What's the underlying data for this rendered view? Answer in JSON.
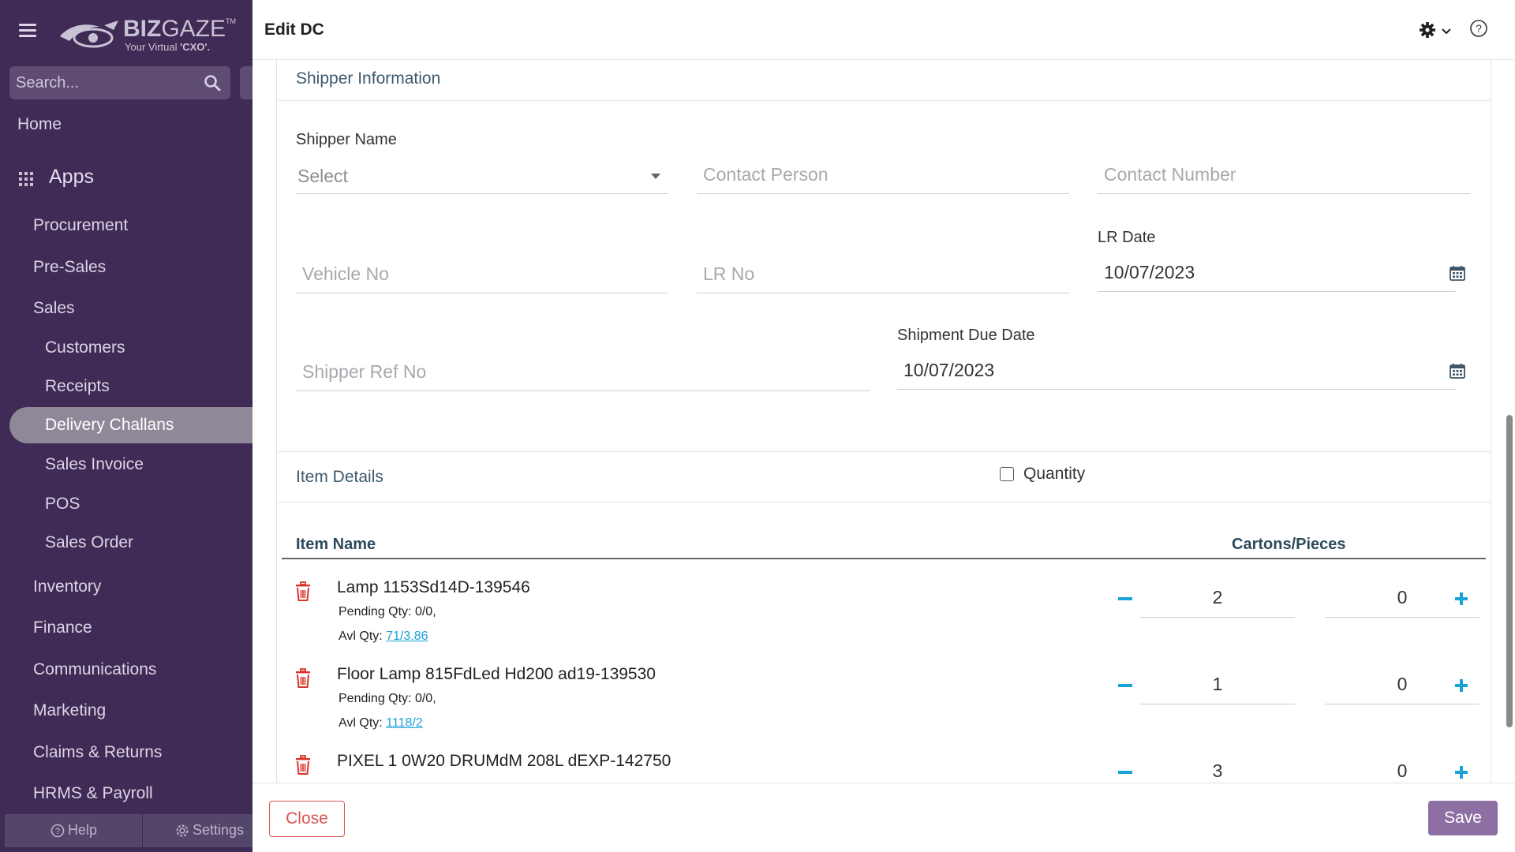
{
  "app": {
    "logo_name_bold": "BIZ",
    "logo_name_light": "GAZE",
    "logo_tm": "TM",
    "logo_tagline_prefix": "Your Virtual ",
    "logo_tagline_bold": "'CXO'."
  },
  "sidebar": {
    "search_placeholder": "Search...",
    "home": "Home",
    "apps": "Apps",
    "items": [
      {
        "label": "Procurement"
      },
      {
        "label": "Pre-Sales"
      },
      {
        "label": "Sales"
      },
      {
        "label": "Customers"
      },
      {
        "label": "Receipts"
      },
      {
        "label": "Delivery Challans"
      },
      {
        "label": "Sales Invoice"
      },
      {
        "label": "POS"
      },
      {
        "label": "Sales Order"
      },
      {
        "label": "Inventory"
      },
      {
        "label": "Finance"
      },
      {
        "label": "Communications"
      },
      {
        "label": "Marketing"
      },
      {
        "label": "Claims & Returns"
      },
      {
        "label": "HRMS & Payroll"
      }
    ],
    "active_item": "Delivery Challans",
    "help": "Help",
    "settings": "Settings"
  },
  "header": {
    "title": "Edit DC"
  },
  "shipper": {
    "section_title": "Shipper Information",
    "shipper_name_label": "Shipper Name",
    "shipper_name_value": "Select",
    "contact_person_placeholder": "Contact Person",
    "contact_number_placeholder": "Contact Number",
    "vehicle_no_placeholder": "Vehicle No",
    "lr_no_placeholder": "LR No",
    "lr_date_label": "LR Date",
    "lr_date_value": "10/07/2023",
    "shipper_ref_placeholder": "Shipper Ref No",
    "shipment_due_label": "Shipment Due Date",
    "shipment_due_value": "10/07/2023"
  },
  "items": {
    "section_title": "Item Details",
    "quantity_checkbox_label": "Quantity",
    "quantity_checked": false,
    "col_item_name": "Item Name",
    "col_cartons": "Cartons/Pieces",
    "rows": [
      {
        "name": "Lamp 1153Sd14D-139546",
        "pending_label": "Pending Qty: 0/0,",
        "avl_label": "Avl Qty: ",
        "avl_link": "71/3.86 ",
        "cartons": "2",
        "pieces": "0"
      },
      {
        "name": "Floor Lamp 815FdLed Hd200 ad19-139530",
        "pending_label": "Pending Qty: 0/0,",
        "avl_label": "Avl Qty: ",
        "avl_link": "1118/2 ",
        "cartons": "1",
        "pieces": "0"
      },
      {
        "name": "PIXEL 1 0W20 DRUMdM 208L dEXP-142750",
        "pending_label": "",
        "avl_label": "",
        "avl_link": "",
        "cartons": "3",
        "pieces": "0"
      }
    ]
  },
  "footer": {
    "close": "Close",
    "save": "Save"
  },
  "colors": {
    "sidebar_bg": "#3f2b56",
    "accent_blue": "#1aa3d9",
    "delete_red": "#d9534f",
    "save_purple": "#8e6fa4"
  }
}
